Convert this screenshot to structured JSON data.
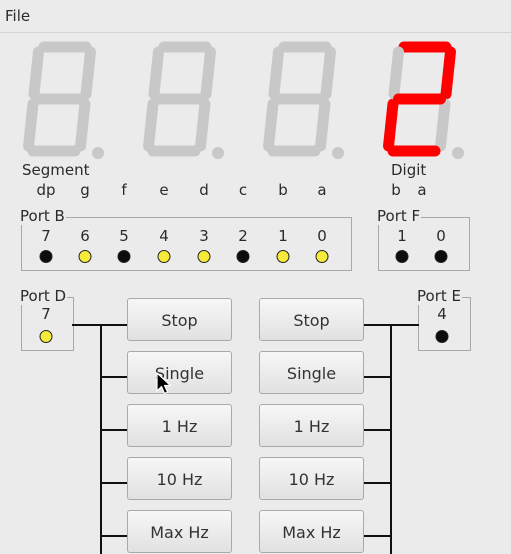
{
  "menu": {
    "file": "File"
  },
  "display": {
    "digits": [
      {
        "lit": [],
        "dp": false
      },
      {
        "lit": [],
        "dp": false
      },
      {
        "lit": [],
        "dp": false
      },
      {
        "lit": [
          "a",
          "b",
          "g",
          "e",
          "d"
        ],
        "dp": false
      }
    ],
    "on_color": "#ff0000",
    "off_color": "#c8c8c8"
  },
  "segment_label": "Segment",
  "segment_letters": [
    "dp",
    "g",
    "f",
    "e",
    "d",
    "c",
    "b",
    "a"
  ],
  "digit_label": "Digit",
  "digit_letters": [
    "b",
    "a"
  ],
  "port_b": {
    "label": "Port B",
    "bits": [
      {
        "n": "7",
        "on": false
      },
      {
        "n": "6",
        "on": true
      },
      {
        "n": "5",
        "on": false
      },
      {
        "n": "4",
        "on": true
      },
      {
        "n": "3",
        "on": true
      },
      {
        "n": "2",
        "on": false
      },
      {
        "n": "1",
        "on": true
      },
      {
        "n": "0",
        "on": true
      }
    ]
  },
  "port_f": {
    "label": "Port F",
    "bits": [
      {
        "n": "1",
        "on": false
      },
      {
        "n": "0",
        "on": false
      }
    ]
  },
  "port_d": {
    "label": "Port D",
    "bit": "7",
    "on": true
  },
  "port_e": {
    "label": "Port E",
    "bit": "4",
    "on": false
  },
  "buttons_left": [
    "Stop",
    "Single",
    "1 Hz",
    "10 Hz",
    "Max Hz"
  ],
  "buttons_right": [
    "Stop",
    "Single",
    "1 Hz",
    "10 Hz",
    "Max Hz"
  ],
  "colors": {
    "led_on": "#f6ea3a",
    "led_off": "#0d0d0d"
  }
}
